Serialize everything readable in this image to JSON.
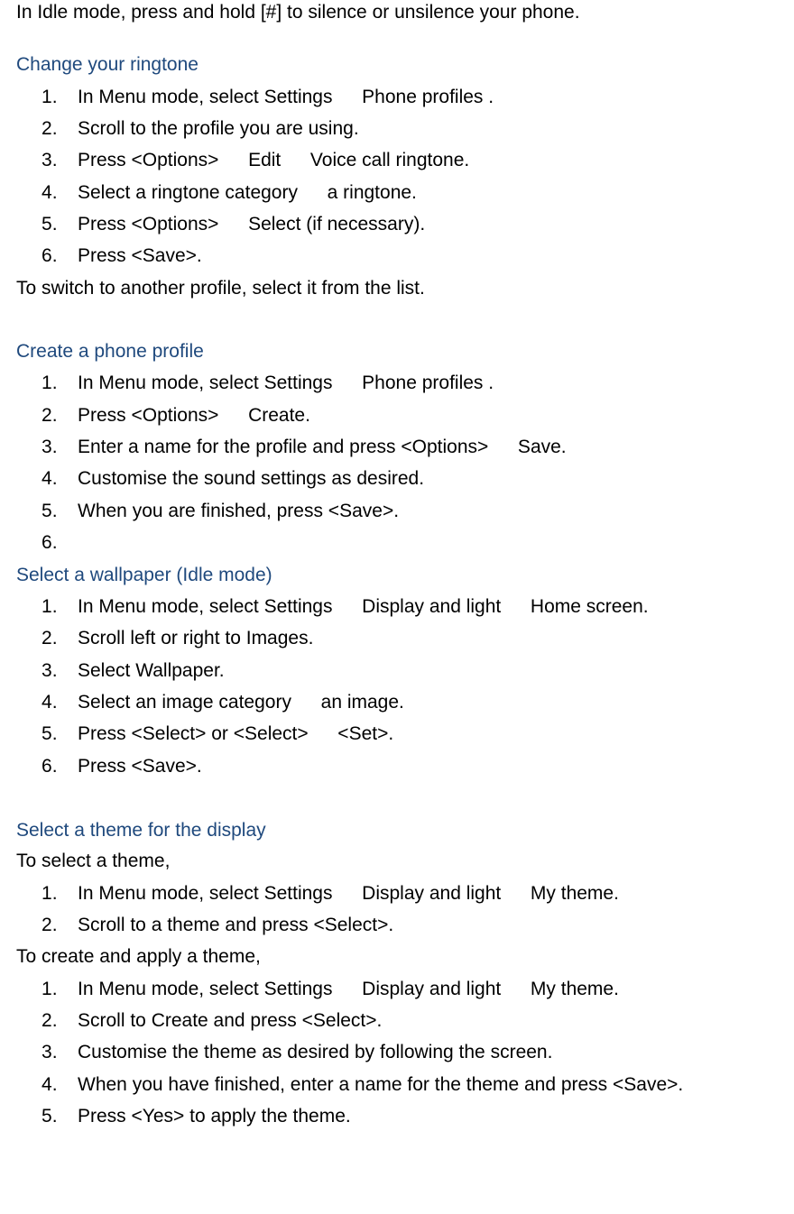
{
  "intro": "In Idle mode, press and hold [#] to silence or unsilence your phone.",
  "sections": {
    "ringtone": {
      "heading": "Change your ringtone",
      "steps": [
        "In Menu mode, select Settings   Phone profiles .",
        "Scroll to the profile you are using.",
        "Press <Options>   Edit   Voice call ringtone.",
        "Select a ringtone category   a ringtone.",
        "Press <Options>   Select (if necessary).",
        "Press <Save>."
      ],
      "outro": "To switch to another profile, select it from the list."
    },
    "profile": {
      "heading": "Create a phone profile",
      "steps": [
        "In Menu mode, select Settings   Phone profiles .",
        "Press <Options>   Create.",
        "Enter a name for the profile and press <Options>   Save.",
        "Customise the sound settings as desired.",
        "When you are finished, press <Save>.",
        ""
      ]
    },
    "wallpaper": {
      "heading": "Select a wallpaper (Idle mode)",
      "steps": [
        "In Menu mode, select Settings   Display and light   Home screen.",
        "Scroll left or right to Images.",
        "Select Wallpaper.",
        "Select an image category   an image.",
        "Press <Select> or <Select>   <Set>.",
        "Press <Save>."
      ]
    },
    "theme": {
      "heading": "Select a theme for the display",
      "intro1": "To select a theme,",
      "steps1": [
        "In Menu mode, select Settings   Display and light   My theme.",
        "Scroll to a theme and press <Select>."
      ],
      "intro2": "To create and apply a theme,",
      "steps2": [
        "In Menu mode, select Settings   Display and light   My theme.",
        "Scroll to Create and press <Select>.",
        "Customise the theme as desired by following the screen.",
        "When you have finished, enter a name for the theme and press <Save>.",
        "Press <Yes> to apply the theme."
      ]
    }
  }
}
